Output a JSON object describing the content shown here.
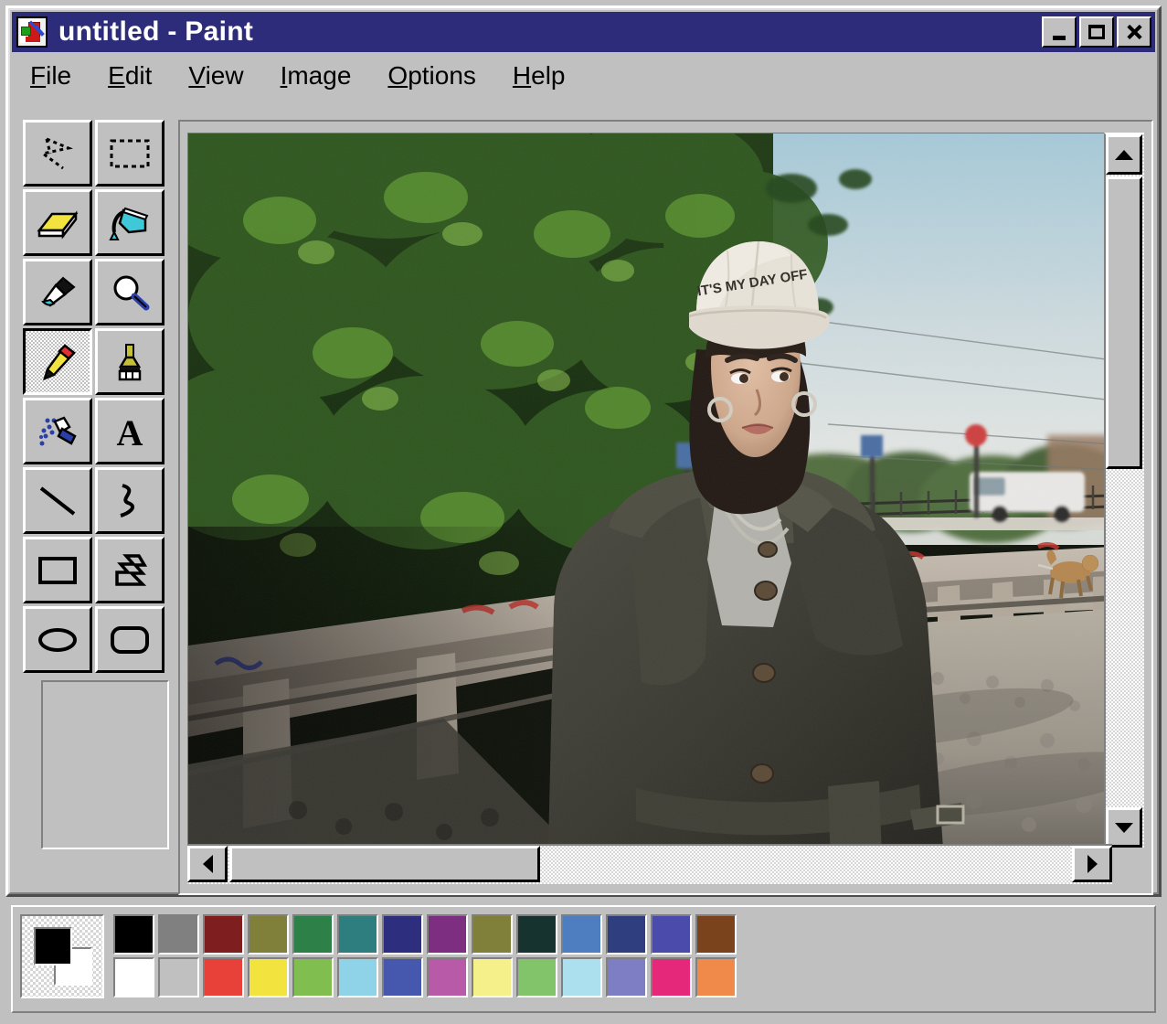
{
  "window": {
    "title": "untitled - Paint",
    "icon": "paint-app-icon",
    "controls": [
      {
        "name": "minimize-button",
        "glyph": "minimize"
      },
      {
        "name": "maximize-button",
        "glyph": "maximize"
      },
      {
        "name": "close-button",
        "glyph": "close"
      }
    ]
  },
  "menu": {
    "items": [
      {
        "label": "File",
        "accel": "F"
      },
      {
        "label": "Edit",
        "accel": "E"
      },
      {
        "label": "View",
        "accel": "V"
      },
      {
        "label": "Image",
        "accel": "I"
      },
      {
        "label": "Options",
        "accel": "O"
      },
      {
        "label": "Help",
        "accel": "H"
      }
    ]
  },
  "toolbox": {
    "tools": [
      {
        "name": "free-form-select-tool",
        "label": "Free-Form Select",
        "selected": false
      },
      {
        "name": "select-tool",
        "label": "Select",
        "selected": false
      },
      {
        "name": "eraser-tool",
        "label": "Eraser",
        "selected": false
      },
      {
        "name": "fill-tool",
        "label": "Fill With Color",
        "selected": false
      },
      {
        "name": "pick-color-tool",
        "label": "Pick Color",
        "selected": false
      },
      {
        "name": "magnifier-tool",
        "label": "Magnifier",
        "selected": false
      },
      {
        "name": "pencil-tool",
        "label": "Pencil",
        "selected": true
      },
      {
        "name": "brush-tool",
        "label": "Brush",
        "selected": false
      },
      {
        "name": "airbrush-tool",
        "label": "Airbrush",
        "selected": false
      },
      {
        "name": "text-tool",
        "label": "Text",
        "selected": false
      },
      {
        "name": "line-tool",
        "label": "Line",
        "selected": false
      },
      {
        "name": "curve-tool",
        "label": "Curve",
        "selected": false
      },
      {
        "name": "rectangle-tool",
        "label": "Rectangle",
        "selected": false
      },
      {
        "name": "polygon-tool",
        "label": "Polygon",
        "selected": false
      },
      {
        "name": "ellipse-tool",
        "label": "Ellipse",
        "selected": false
      },
      {
        "name": "rounded-rectangle-tool",
        "label": "Rounded Rectangle",
        "selected": false
      }
    ],
    "options_panel_empty": true
  },
  "canvas": {
    "image_description": "Photograph of a young woman standing on a stone bridge walkway, wearing a white baseball cap, dark olive trench coat over a grey t-shirt, silver chain necklaces and a black choker. Behind her, leafy green trees, a graffiti-marked stone balustrade, a cobblestone path with a dog walking, a parked white van and pale blue sky.",
    "cap_text": "IT'S MY DAY OFF",
    "scrollbars": {
      "vertical": {
        "thumb_position_pct": 0,
        "thumb_size_pct": 41
      },
      "horizontal": {
        "thumb_position_pct": 0,
        "thumb_size_pct": 34
      }
    }
  },
  "palette": {
    "foreground_color": "#000000",
    "background_color": "#ffffff",
    "colors_row1": [
      "#000000",
      "#808080",
      "#7e1e1e",
      "#80803a",
      "#2e8049",
      "#2e7e80",
      "#2e2e7e",
      "#7e2e80",
      "#80803a",
      "#17332f",
      "#4f7ec0",
      "#2e3e7e",
      "#4b4bab",
      "#7a431c"
    ],
    "colors_row2": [
      "#ffffff",
      "#c0c0c0",
      "#e8413a",
      "#f2e33f",
      "#7fbe4f",
      "#8ed3e8",
      "#4558ae",
      "#b85aa8",
      "#f5f08a",
      "#82c469",
      "#ade0ef",
      "#7e7ec4",
      "#e5287a",
      "#ef8a4a"
    ]
  }
}
